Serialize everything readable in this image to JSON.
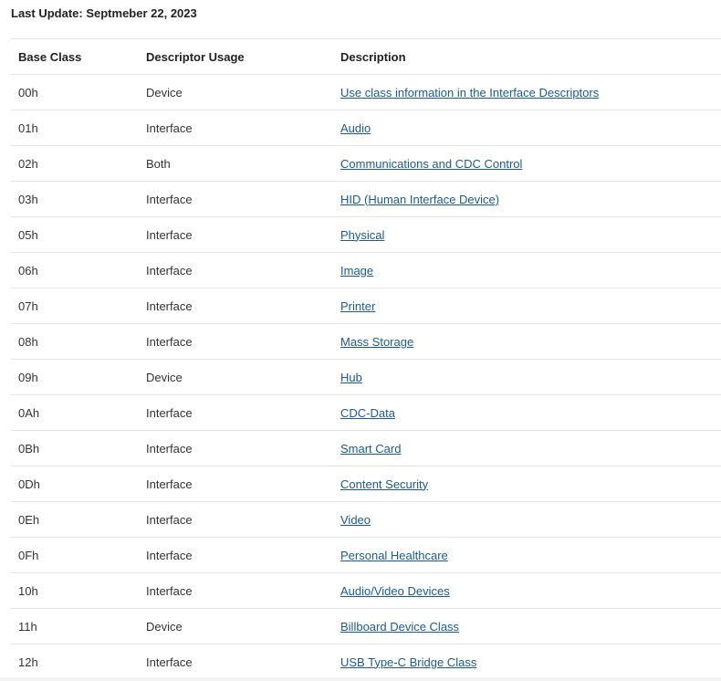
{
  "last_update": "Last Update: Septmeber 22, 2023",
  "table": {
    "headers": [
      "Base Class",
      "Descriptor Usage",
      "Description"
    ],
    "rows": [
      {
        "base_class": "00h",
        "usage": "Device",
        "description": "Use class information in the Interface Descriptors"
      },
      {
        "base_class": "01h",
        "usage": "Interface",
        "description": "Audio"
      },
      {
        "base_class": "02h",
        "usage": "Both",
        "description": "Communications and CDC Control"
      },
      {
        "base_class": "03h",
        "usage": "Interface",
        "description": "HID (Human Interface Device)"
      },
      {
        "base_class": "05h",
        "usage": "Interface",
        "description": "Physical"
      },
      {
        "base_class": "06h",
        "usage": "Interface",
        "description": "Image"
      },
      {
        "base_class": "07h",
        "usage": "Interface",
        "description": "Printer"
      },
      {
        "base_class": "08h",
        "usage": "Interface",
        "description": "Mass Storage"
      },
      {
        "base_class": "09h",
        "usage": "Device",
        "description": "Hub"
      },
      {
        "base_class": "0Ah",
        "usage": "Interface",
        "description": "CDC-Data"
      },
      {
        "base_class": "0Bh",
        "usage": "Interface",
        "description": "Smart Card"
      },
      {
        "base_class": "0Dh",
        "usage": "Interface",
        "description": "Content Security"
      },
      {
        "base_class": "0Eh",
        "usage": "Interface",
        "description": "Video"
      },
      {
        "base_class": "0Fh",
        "usage": "Interface",
        "description": "Personal Healthcare"
      },
      {
        "base_class": "10h",
        "usage": "Interface",
        "description": "Audio/Video Devices"
      },
      {
        "base_class": "11h",
        "usage": "Device",
        "description": "Billboard Device Class"
      },
      {
        "base_class": "12h",
        "usage": "Interface",
        "description": "USB Type-C Bridge Class"
      }
    ]
  },
  "colors": {
    "link": "#1a5a96",
    "row_divider": "#e4e4e4",
    "text": "#333333"
  }
}
